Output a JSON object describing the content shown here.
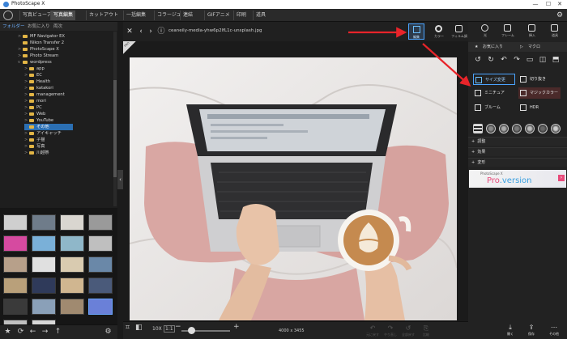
{
  "window": {
    "title": "PhotoScape X",
    "minimize": "—",
    "maximize": "☐",
    "close": "✕"
  },
  "menu": {
    "tabs": [
      "写真ビューア",
      "写真編集",
      "カットアウト",
      "一括編集",
      "コラージュ",
      "連結",
      "GIFアニメ",
      "印刷",
      "道具"
    ],
    "active": "写真編集"
  },
  "left": {
    "tabs": [
      "フォルダー",
      "お気に入り",
      "両次"
    ],
    "tree": [
      {
        "label": "MF Navigator EX",
        "depth": 1,
        "arrow": ">"
      },
      {
        "label": "Nikon Transfer 2",
        "depth": 1,
        "arrow": ""
      },
      {
        "label": "PhotoScape X",
        "depth": 1,
        "arrow": ">"
      },
      {
        "label": "Photo Stream",
        "depth": 1,
        "arrow": ">"
      },
      {
        "label": "wordpress",
        "depth": 1,
        "arrow": "v"
      },
      {
        "label": "app",
        "depth": 2,
        "arrow": ">"
      },
      {
        "label": "EC",
        "depth": 2,
        "arrow": ">"
      },
      {
        "label": "Health",
        "depth": 2,
        "arrow": ">"
      },
      {
        "label": "katakori",
        "depth": 2,
        "arrow": ">"
      },
      {
        "label": "management",
        "depth": 2,
        "arrow": ">"
      },
      {
        "label": "mori",
        "depth": 2,
        "arrow": ">"
      },
      {
        "label": "PC",
        "depth": 2,
        "arrow": ">"
      },
      {
        "label": "Web",
        "depth": 2,
        "arrow": ">"
      },
      {
        "label": "YouTube",
        "depth": 2,
        "arrow": ">"
      },
      {
        "label": "その他",
        "depth": 2,
        "arrow": "",
        "selected": true
      },
      {
        "label": "アイキャッチ",
        "depth": 2,
        "arrow": ">"
      },
      {
        "label": "子猫",
        "depth": 2,
        "arrow": ">"
      },
      {
        "label": "写真",
        "depth": 2,
        "arrow": ">"
      },
      {
        "label": "川越祭",
        "depth": 2,
        "arrow": ">"
      }
    ],
    "thumb_colors": [
      "#cfcfcf",
      "#6f7c8a",
      "#d9d6d0",
      "#9a9a9a",
      "#d64aa0",
      "#7ab0d8",
      "#8fb7c9",
      "#bfbfbf",
      "#b7a08a",
      "#e0e0e0",
      "#d9cbb0",
      "#6a88a8",
      "#b9a07a",
      "#2f3a5a",
      "#d0b690",
      "#4a5a7a",
      "#3a3a3a",
      "#8aa0b8",
      "#a08a70",
      "#6a80d8",
      "#c0c0c0",
      "#d8d8d8"
    ],
    "bottom_icons": [
      "★",
      "⟳",
      "←",
      "→",
      "↑",
      "⚙"
    ]
  },
  "center": {
    "filename": "ceaneily-media-yhw6p2lfL1c-unsplash.jpg",
    "nav": [
      "✕",
      "‹",
      "›",
      "ⓘ"
    ],
    "edit_label": "編集",
    "toolbar": [
      {
        "icon": "circle-icon",
        "label": "カラー"
      },
      {
        "icon": "film-icon",
        "label": "フィルム調"
      },
      {
        "icon": "sun-icon",
        "label": "光"
      },
      {
        "icon": "frame-icon",
        "label": "フレーム"
      },
      {
        "icon": "insert-icon",
        "label": "挿入"
      },
      {
        "icon": "tools-icon",
        "label": "道具"
      }
    ],
    "pro_badge": "PRO",
    "bottom": {
      "zoom_pct": "10X",
      "fit": "1:1",
      "dimensions": "4000 x 3455",
      "zoom_level": 0.2,
      "actions": [
        {
          "icon": "↶",
          "label": "元に戻す"
        },
        {
          "icon": "↷",
          "label": "やり直し"
        },
        {
          "icon": "↺",
          "label": "全部戻す"
        },
        {
          "icon": "⎘",
          "label": "比較"
        },
        {
          "icon": "⤓",
          "label": "開く"
        },
        {
          "icon": "⇪",
          "label": "保存"
        },
        {
          "icon": "⋯",
          "label": "その他"
        }
      ]
    }
  },
  "right": {
    "favorites": "お気に入り",
    "macro": "マクロ",
    "options": [
      {
        "label": "サイズ変更",
        "active": true
      },
      {
        "label": "切り抜き",
        "active": false
      },
      {
        "label": "ミニチュア",
        "active": false
      },
      {
        "label": "マジックカラー",
        "active": false,
        "magic": true
      },
      {
        "label": "ブルーム",
        "active": false
      },
      {
        "label": "HDR",
        "active": false
      }
    ],
    "sections": [
      "調整",
      "効果",
      "変形"
    ],
    "promo": {
      "line1": "PhotoScape X",
      "brand_pro": "Pro",
      "brand_rest": ".version"
    }
  },
  "colors": {
    "accent": "#4aa3ff",
    "arrow": "#e8242a",
    "selection": "#2b6fb3"
  }
}
